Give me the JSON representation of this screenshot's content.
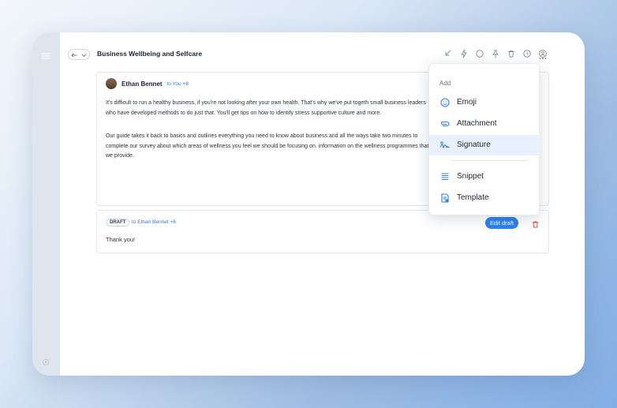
{
  "thread": {
    "subject": "Business Wellbeing and Selfcare"
  },
  "message": {
    "sender": "Ethan Bennet",
    "recipients": "to You +8",
    "paragraph1": "It's difficult to run a healthy business, if you're not looking after your own health. That's why we've put togeth small business leaders who have developed methods to do just that. You'll get tips on how to identify stress supportive culture and more.",
    "paragraph2": "Our guide takes it back to basics and outlines everything you need to know about business and all the ways take two minutes to complete our survey about which areas of wellness you feel we should be focusing on. information on the wellness programmes that we provide."
  },
  "draft": {
    "badge": "DRAFT",
    "recipients": "to Ethan Bennet +6",
    "text": "Thank you!",
    "edit_label": "Edit draft"
  },
  "add_menu": {
    "heading": "Add",
    "items": [
      {
        "label": "Emoji",
        "icon": "emoji-icon"
      },
      {
        "label": "Attachment",
        "icon": "paperclip-icon"
      },
      {
        "label": "Signature",
        "icon": "signature-icon",
        "active": true
      },
      {
        "label": "Snippet",
        "icon": "snippet-icon"
      },
      {
        "label": "Template",
        "icon": "template-icon"
      }
    ]
  },
  "colors": {
    "accent": "#2f80ed",
    "danger": "#e0524f",
    "sidebar": "#dfe5ee"
  }
}
